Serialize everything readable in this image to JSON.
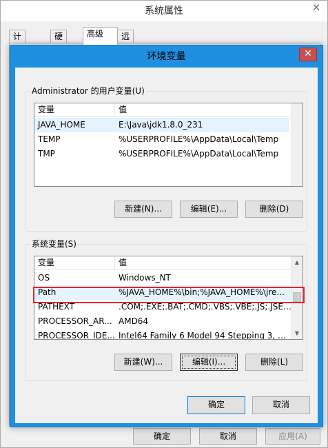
{
  "system_properties": {
    "title": "系统属性",
    "tabs": [
      {
        "label": "计算机名"
      },
      {
        "label": "硬件"
      },
      {
        "label": "高级"
      },
      {
        "label": "远程"
      }
    ],
    "buttons": {
      "ok": "确定",
      "cancel": "取消",
      "apply": "应用(A)"
    }
  },
  "env_dialog": {
    "title": "环境变量",
    "user_vars": {
      "group_label": "Administrator 的用户变量(U)",
      "columns": {
        "name": "变量",
        "value": "值"
      },
      "rows": [
        {
          "name": "JAVA_HOME",
          "value": "E:\\Java\\jdk1.8.0_231"
        },
        {
          "name": "TEMP",
          "value": "%USERPROFILE%\\AppData\\Local\\Temp"
        },
        {
          "name": "TMP",
          "value": "%USERPROFILE%\\AppData\\Local\\Temp"
        }
      ],
      "buttons": {
        "new": "新建(N)...",
        "edit": "编辑(E)...",
        "delete": "删除(D)"
      }
    },
    "system_vars": {
      "group_label": "系统变量(S)",
      "columns": {
        "name": "变量",
        "value": "值"
      },
      "rows": [
        {
          "name": "OS",
          "value": "Windows_NT"
        },
        {
          "name": "Path",
          "value": "%JAVA_HOME%\\bin;%JAVA_HOME%\\jre..."
        },
        {
          "name": "PATHEXT",
          "value": ".COM;.EXE;.BAT;.CMD;.VBS;.VBE;.JS;.JSE;..."
        },
        {
          "name": "PROCESSOR_AR...",
          "value": "AMD64"
        },
        {
          "name": "PROCESSOR_IDE...",
          "value": "Intel64 Family 6 Model 94 Stepping 3, G..."
        }
      ],
      "buttons": {
        "new": "新建(W)...",
        "edit": "编辑(I)...",
        "delete": "删除(L)"
      }
    },
    "buttons": {
      "ok": "确定",
      "cancel": "取消"
    }
  },
  "icons": {
    "close": "close-icon",
    "scroll_up": "chevron-up-icon",
    "scroll_down": "chevron-down-icon"
  },
  "colors": {
    "titlebar_accent": "#1f8fe0",
    "selected_row": "#e5f3ff",
    "highlight": "#e0272a"
  }
}
